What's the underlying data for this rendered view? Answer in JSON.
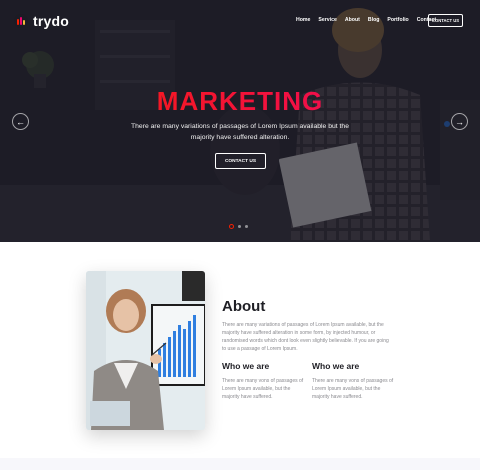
{
  "brand": {
    "name": "trydo",
    "mark_colors": [
      "#f81f01",
      "#ee076e",
      "#f6b83b"
    ]
  },
  "nav": {
    "items": [
      "Home",
      "Service",
      "About",
      "Blog",
      "Portfolio",
      "Contact"
    ],
    "cta_label": "CONTACT US"
  },
  "hero": {
    "title": "MARKETING",
    "description": "There are many variations of passages of Lorem Ipsum available but the majority have suffered alteration.",
    "button_label": "CONTACT US",
    "prev_icon": "arrow-left-icon",
    "next_icon": "arrow-right-icon",
    "slides_total": 3,
    "slide_active": 1,
    "accent": "#f81f01"
  },
  "about": {
    "title": "About",
    "description": "There are many variations of passages of Lorem Ipsum available, but the majority have suffered alteration in some form, by injected humour, or randomised words which dont look even slightly believable. If you are going to use a passage of Lorem Ipsum.",
    "columns": [
      {
        "heading": "Who we are",
        "text": "There are many vons of passages of Lorem Ipsum available, but the majority have suffered."
      },
      {
        "heading": "Who we are",
        "text": "There are many vons of passages of Lorem Ipsum available, but the majority have suffered."
      }
    ]
  }
}
